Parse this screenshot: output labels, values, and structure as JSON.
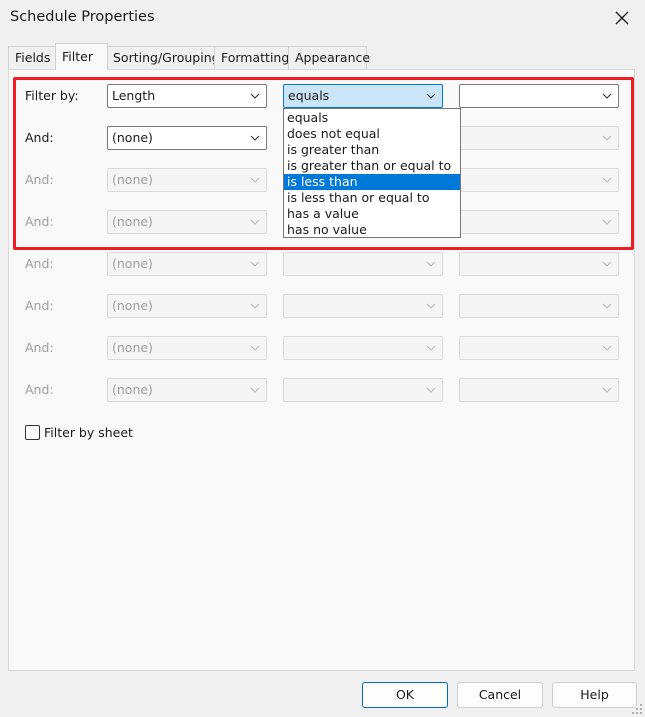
{
  "window": {
    "title": "Schedule Properties",
    "close_icon": "close-icon"
  },
  "tabs": [
    {
      "label": "Fields",
      "active": false
    },
    {
      "label": "Filter",
      "active": true
    },
    {
      "label": "Sorting/Grouping",
      "active": false
    },
    {
      "label": "Formatting",
      "active": false
    },
    {
      "label": "Appearance",
      "active": false
    }
  ],
  "filter": {
    "rows": [
      {
        "label": "Filter by:",
        "field": "Length",
        "condition": "equals",
        "value": "",
        "enabled": true
      },
      {
        "label": "And:",
        "field": "(none)",
        "condition": "",
        "value": "",
        "enabled": true
      },
      {
        "label": "And:",
        "field": "(none)",
        "condition": "",
        "value": "",
        "enabled": false
      },
      {
        "label": "And:",
        "field": "(none)",
        "condition": "",
        "value": "",
        "enabled": false
      },
      {
        "label": "And:",
        "field": "(none)",
        "condition": "",
        "value": "",
        "enabled": false
      },
      {
        "label": "And:",
        "field": "(none)",
        "condition": "",
        "value": "",
        "enabled": false
      },
      {
        "label": "And:",
        "field": "(none)",
        "condition": "",
        "value": "",
        "enabled": false
      },
      {
        "label": "And:",
        "field": "(none)",
        "condition": "",
        "value": "",
        "enabled": false
      }
    ],
    "condition_dropdown": {
      "options": [
        "equals",
        "does not equal",
        "is greater than",
        "is greater than or equal to",
        "is less than",
        "is less than or equal to",
        "has a value",
        "has no value"
      ],
      "highlighted": "is less than"
    },
    "filter_by_sheet": {
      "label": "Filter by sheet",
      "checked": false
    }
  },
  "buttons": {
    "ok": "OK",
    "cancel": "Cancel",
    "help": "Help"
  },
  "colors": {
    "highlight_border": "#ee1c25",
    "selection": "#0078d7",
    "focus_fill": "#cce4f7"
  }
}
